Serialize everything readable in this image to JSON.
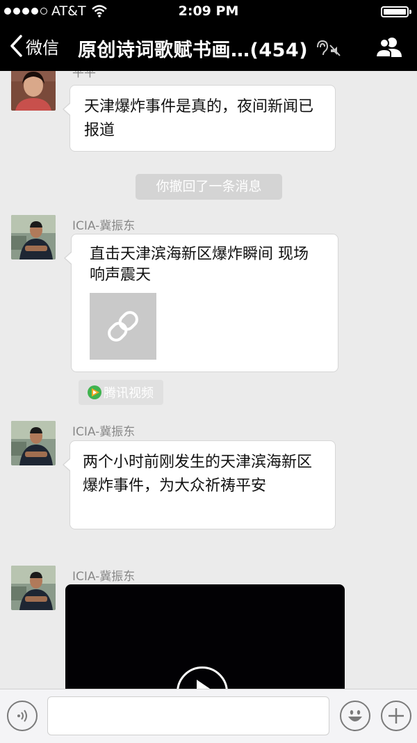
{
  "status_bar": {
    "carrier": "AT&T",
    "time": "2:09 PM"
  },
  "nav": {
    "back_label": "微信",
    "title": "原创诗词歌赋书画…(454)"
  },
  "messages": [
    {
      "sender": "平平",
      "text": "天津爆炸事件是真的，夜间新闻已报道"
    },
    {
      "system_text": "你撤回了一条消息"
    },
    {
      "sender": "ICIA-冀振东",
      "text": "直击天津滨海新区爆炸瞬间  现场响声震天",
      "source": "腾讯视频"
    },
    {
      "sender": "ICIA-冀振东",
      "text": "两个小时前刚发生的天津滨海新区爆炸事件，为大众祈祷平安"
    },
    {
      "sender": "ICIA-冀振东",
      "type": "video"
    }
  ],
  "colors": {
    "nav_bg": "#000000",
    "chat_bg": "#ebebeb",
    "bubble_bg": "#ffffff",
    "system_pill": "#d4d4d4"
  },
  "icons": {
    "back": "chevron-left-icon",
    "mute": "ear-muted-icon",
    "group": "group-members-icon",
    "link": "link-icon",
    "voice": "voice-icon",
    "emoji": "emoji-icon",
    "add": "plus-icon"
  }
}
